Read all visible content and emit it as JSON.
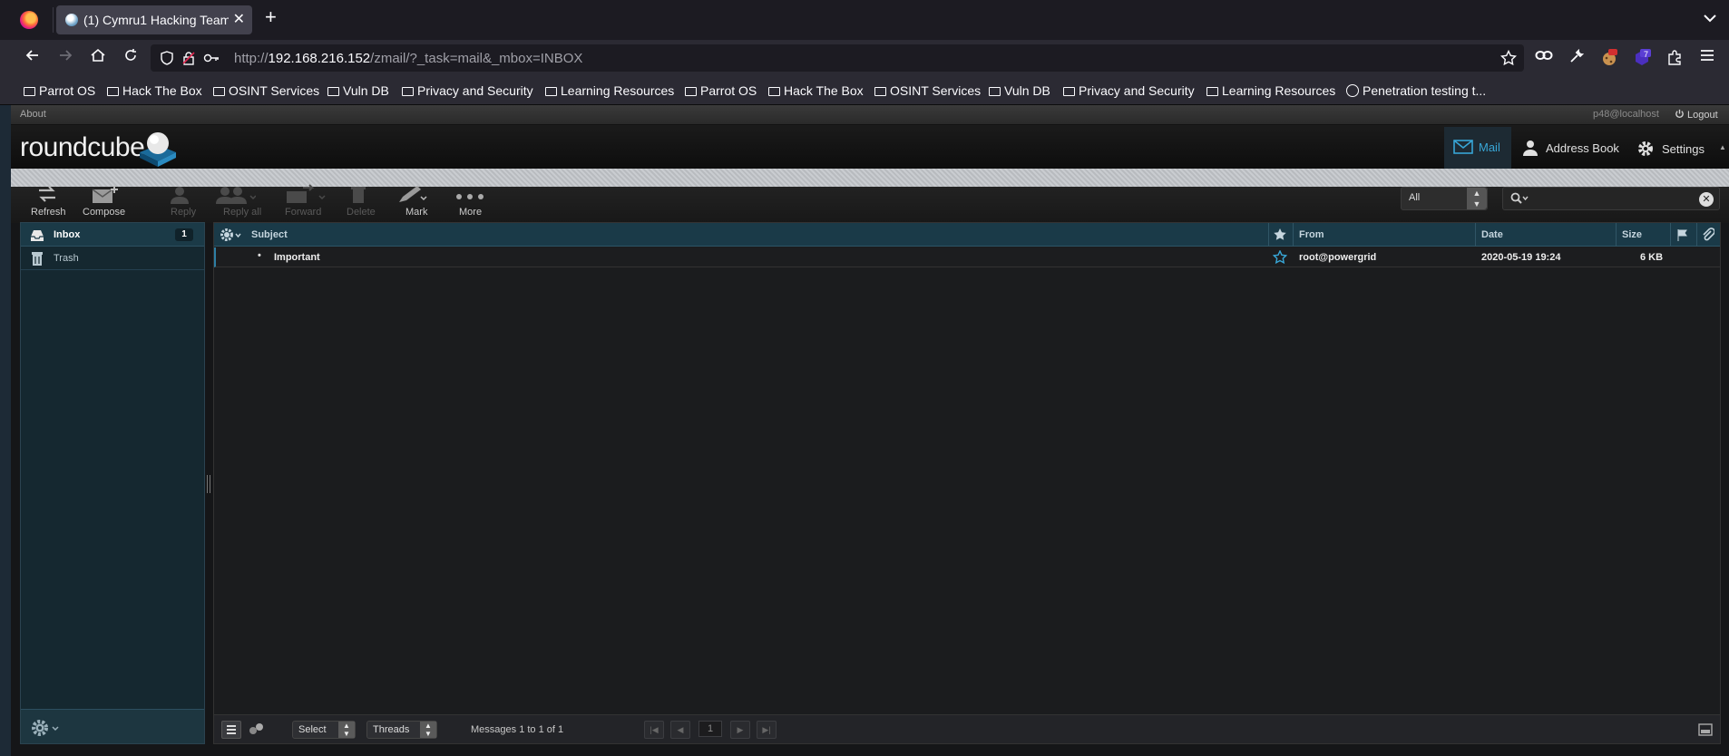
{
  "browser": {
    "tab_title": "(1) Cymru1 Hacking Team",
    "tab_close": "✕",
    "new_tab": "+",
    "url_prefix": "http://",
    "url_host": "192.168.216.152",
    "url_path": "/zmail/?_task=mail&_mbox=INBOX",
    "extension_badge": "7"
  },
  "bookmarks": [
    {
      "label": "Parrot OS"
    },
    {
      "label": "Hack The Box"
    },
    {
      "label": "OSINT Services"
    },
    {
      "label": "Vuln DB"
    },
    {
      "label": "Privacy and Security"
    },
    {
      "label": "Learning Resources"
    },
    {
      "label": "Parrot OS"
    },
    {
      "label": "Hack The Box"
    },
    {
      "label": "OSINT Services"
    },
    {
      "label": "Vuln DB"
    },
    {
      "label": "Privacy and Security"
    },
    {
      "label": "Learning Resources"
    },
    {
      "label": "Penetration testing t..."
    }
  ],
  "top": {
    "about": "About",
    "user": "p48@localhost",
    "logout": "Logout"
  },
  "logo": "roundcube",
  "tasks": {
    "mail": "Mail",
    "address_book": "Address Book",
    "settings": "Settings"
  },
  "toolbar": {
    "refresh": "Refresh",
    "compose": "Compose",
    "reply": "Reply",
    "reply_all": "Reply all",
    "forward": "Forward",
    "delete": "Delete",
    "mark": "Mark",
    "more": "More"
  },
  "search": {
    "filter": "All",
    "query": ""
  },
  "folders": {
    "inbox": "Inbox",
    "inbox_unread": "1",
    "trash": "Trash"
  },
  "list": {
    "headers": {
      "subject": "Subject",
      "from": "From",
      "date": "Date",
      "size": "Size"
    },
    "rows": [
      {
        "subject": "Important",
        "from": "root@powergrid",
        "date": "2020-05-19 19:24",
        "size": "6 KB"
      }
    ]
  },
  "footer": {
    "select": "Select",
    "threads": "Threads",
    "count": "Messages 1 to 1 of 1",
    "page": "1"
  },
  "colors": {
    "accent": "#38a6d6",
    "folder_bg": "#152830",
    "header_bg": "#1a3a48"
  }
}
